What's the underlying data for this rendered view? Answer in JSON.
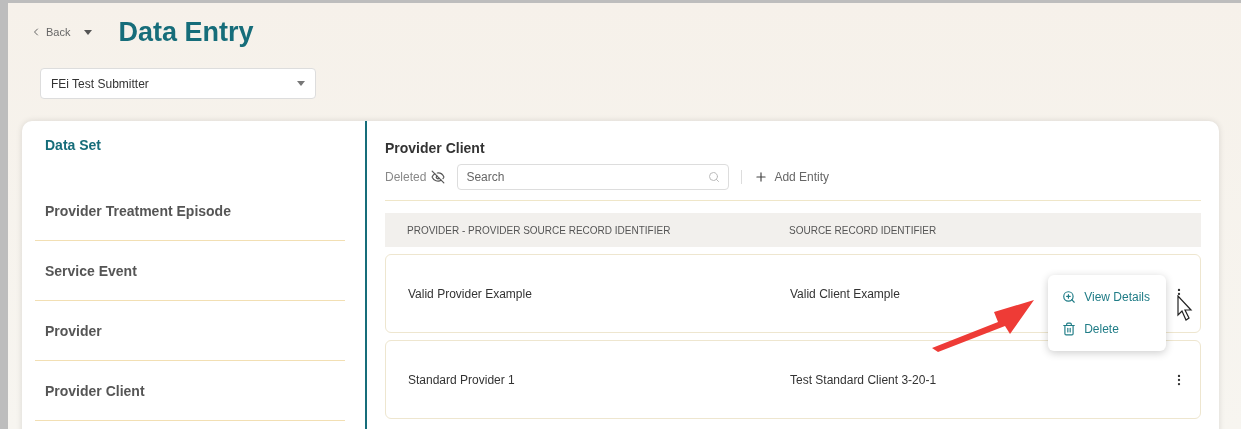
{
  "header": {
    "back": "Back",
    "title": "Data Entry"
  },
  "submitter": {
    "value": "FEi Test Submitter"
  },
  "sidebar": {
    "title": "Data Set",
    "items": [
      {
        "label": "Provider Treatment Episode"
      },
      {
        "label": "Service Event"
      },
      {
        "label": "Provider"
      },
      {
        "label": "Provider Client"
      }
    ]
  },
  "panel": {
    "title": "Provider Client",
    "deleted_label": "Deleted",
    "search": {
      "placeholder": "Search"
    },
    "add_button": "Add Entity"
  },
  "table": {
    "columns": [
      "PROVIDER - PROVIDER SOURCE RECORD IDENTIFIER",
      "SOURCE RECORD IDENTIFIER"
    ],
    "rows": [
      {
        "cells": [
          "Valid Provider Example",
          "Valid Client Example"
        ]
      },
      {
        "cells": [
          "Standard Provider 1",
          "Test Standard Client 3-20-1"
        ]
      }
    ]
  },
  "row_menu": {
    "items": [
      {
        "kind": "view",
        "label": "View Details"
      },
      {
        "kind": "delete",
        "label": "Delete"
      }
    ]
  }
}
